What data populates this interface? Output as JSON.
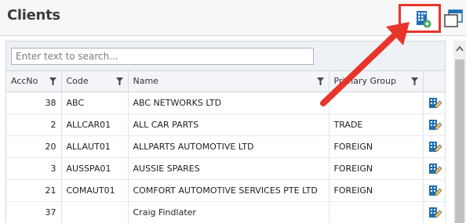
{
  "page": {
    "title": "Clients"
  },
  "toolbar": {
    "add_icon": "add-building-icon",
    "window_icon": "window-restore-icon"
  },
  "search": {
    "placeholder": "Enter text to search...",
    "value": ""
  },
  "columns": [
    {
      "label": "AccNo"
    },
    {
      "label": "Code"
    },
    {
      "label": "Name"
    },
    {
      "label": "Primary Group"
    },
    {
      "label": ""
    }
  ],
  "rows": [
    {
      "accno": "38",
      "code": "ABC",
      "name": "ABC NETWORKS LTD",
      "group": ""
    },
    {
      "accno": "2",
      "code": "ALLCAR01",
      "name": "ALL CAR PARTS",
      "group": "TRADE"
    },
    {
      "accno": "20",
      "code": "ALLAUT01",
      "name": "ALLPARTS AUTOMOTIVE LTD",
      "group": "FOREIGN"
    },
    {
      "accno": "3",
      "code": "AUSSPA01",
      "name": "AUSSIE SPARES",
      "group": "FOREIGN"
    },
    {
      "accno": "21",
      "code": "COMAUT01",
      "name": "COMFORT AUTOMOTIVE SERVICES PTE LTD",
      "group": "FOREIGN"
    },
    {
      "accno": "37",
      "code": "",
      "name": "Craig Findlater",
      "group": ""
    }
  ],
  "colors": {
    "highlight": "#e8352c",
    "accent": "#1f6fb2",
    "add_badge": "#3aa655"
  }
}
